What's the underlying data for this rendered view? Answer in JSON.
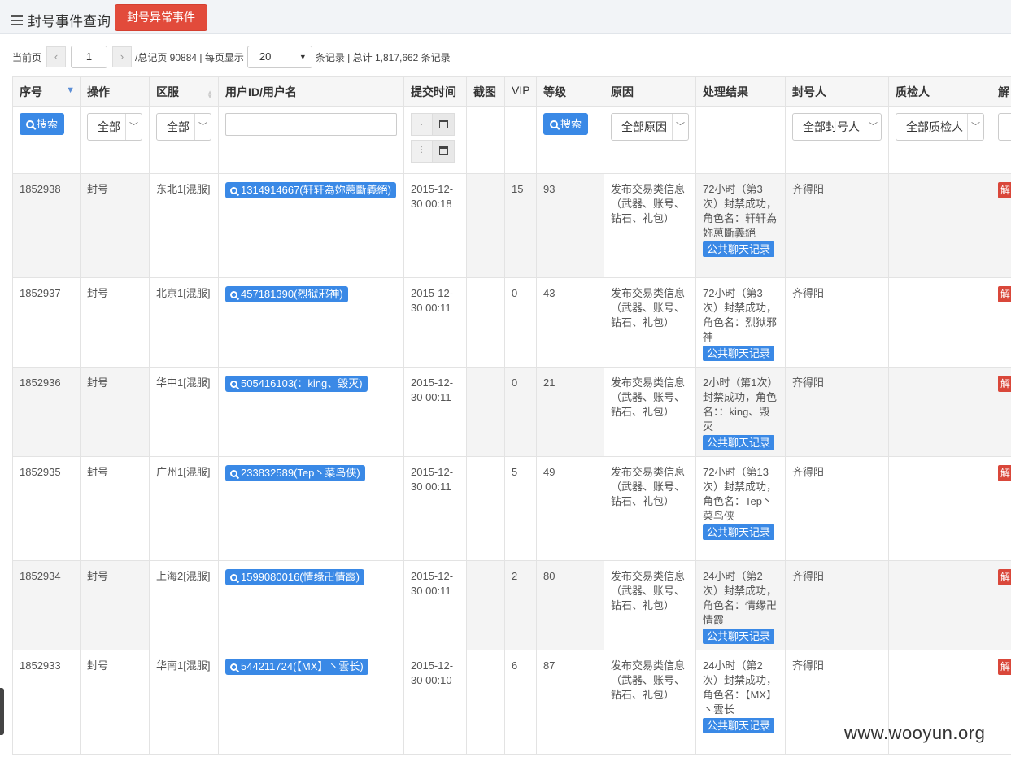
{
  "header": {
    "title": "封号事件查询",
    "abnormal_button": "封号异常事件"
  },
  "pager": {
    "current_label": "当前页",
    "prev_icon": "‹",
    "page_value": "1",
    "next_icon": "›",
    "total_pages_text": "/总记页 90884 | 每页显示",
    "per_page_value": "20",
    "summary_text": "条记录 | 总计 1,817,662 条记录"
  },
  "columns": [
    "序号",
    "操作",
    "区服",
    "用户ID/用户名",
    "提交时间",
    "截图",
    "VIP",
    "等级",
    "原因",
    "处理结果",
    "封号人",
    "质检人",
    "解"
  ],
  "filters": {
    "search_label": "搜索",
    "op_all": "全部",
    "zone_all": "全部",
    "reason_all": "全部原因",
    "banner_all": "全部封号人",
    "qc_all": "全部质检人"
  },
  "rows": [
    {
      "id": "1852938",
      "op": "封号",
      "zone": "东北1[混服]",
      "user": "1314914667(轩轩為妳蒽斷義絕)",
      "time": "2015-12-30 00:18",
      "vip": "15",
      "level": "93",
      "reason": "发布交易类信息（武器、账号、钻石、礼包）",
      "result": "72小时（第3次）封禁成功，角色名：轩轩為妳蒽斷義絕",
      "chat": "公共聊天记录",
      "banner": "齐得阳",
      "unban": "解"
    },
    {
      "id": "1852937",
      "op": "封号",
      "zone": "北京1[混服]",
      "user": "457181390(烈狱邪神)",
      "time": "2015-12-30 00:11",
      "vip": "0",
      "level": "43",
      "reason": "发布交易类信息（武器、账号、钻石、礼包）",
      "result": "72小时（第3次）封禁成功，角色名：烈狱邪神",
      "chat": "公共聊天记录",
      "banner": "齐得阳",
      "unban": "解"
    },
    {
      "id": "1852936",
      "op": "封号",
      "zone": "华中1[混服]",
      "user": "505416103(：king、毁灭)",
      "time": "2015-12-30 00:11",
      "vip": "0",
      "level": "21",
      "reason": "发布交易类信息（武器、账号、钻石、礼包）",
      "result": "2小时（第1次）封禁成功，角色名：：king、毁灭",
      "chat": "公共聊天记录",
      "banner": "齐得阳",
      "unban": "解"
    },
    {
      "id": "1852935",
      "op": "封号",
      "zone": "广州1[混服]",
      "user": "233832589(Tep丶菜鸟侠)",
      "time": "2015-12-30 00:11",
      "vip": "5",
      "level": "49",
      "reason": "发布交易类信息（武器、账号、钻石、礼包）",
      "result": "72小时（第13次）封禁成功，角色名：Tep丶菜鸟侠",
      "chat": "公共聊天记录",
      "banner": "齐得阳",
      "unban": "解"
    },
    {
      "id": "1852934",
      "op": "封号",
      "zone": "上海2[混服]",
      "user": "1599080016(情缘卍情霞)",
      "time": "2015-12-30 00:11",
      "vip": "2",
      "level": "80",
      "reason": "发布交易类信息（武器、账号、钻石、礼包）",
      "result": "24小时（第2次）封禁成功，角色名：情缘卍情霞",
      "chat": "公共聊天记录",
      "banner": "齐得阳",
      "unban": "解"
    },
    {
      "id": "1852933",
      "op": "封号",
      "zone": "华南1[混服]",
      "user": "544211724(【MX】丶雲长)",
      "time": "2015-12-30 00:10",
      "vip": "6",
      "level": "87",
      "reason": "发布交易类信息（武器、账号、钻石、礼包）",
      "result": "24小时（第2次）封禁成功，角色名：【MX】丶雲长",
      "chat": "公共聊天记录",
      "banner": "齐得阳",
      "unban": "解"
    }
  ],
  "watermark": "www.wooyun.org"
}
